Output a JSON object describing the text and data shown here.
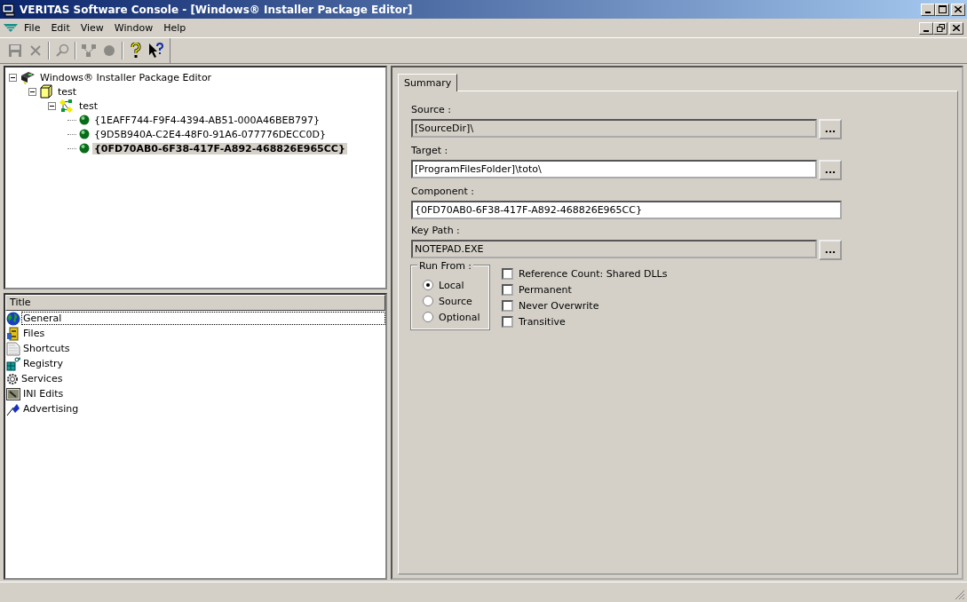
{
  "window": {
    "title": "VERITAS Software Console - [Windows® Installer Package Editor]"
  },
  "menu": [
    "File",
    "Edit",
    "View",
    "Window",
    "Help"
  ],
  "toolbar": [
    {
      "kind": "save",
      "disabled": true
    },
    {
      "kind": "delete",
      "disabled": true
    },
    {
      "kind": "separator"
    },
    {
      "kind": "find",
      "disabled": true
    },
    {
      "kind": "separator"
    },
    {
      "kind": "tree",
      "disabled": true
    },
    {
      "kind": "ball",
      "disabled": true
    },
    {
      "kind": "separator"
    },
    {
      "kind": "help",
      "disabled": false
    },
    {
      "kind": "whats-this",
      "disabled": false
    }
  ],
  "tree": [
    {
      "label": "Windows® Installer Package Editor",
      "kind": "package",
      "expanded": true,
      "selected": false,
      "children": [
        {
          "label": "test",
          "kind": "box",
          "expanded": true,
          "selected": false,
          "children": [
            {
              "label": "test",
              "kind": "network",
              "expanded": true,
              "selected": false,
              "children": [
                {
                  "label": "{1EAFF744-F9F4-4394-AB51-000A46BEB797}",
                  "kind": "ball",
                  "selected": false
                },
                {
                  "label": "{9D5B940A-C2E4-48F0-91A6-077776DECC0D}",
                  "kind": "ball",
                  "selected": false
                },
                {
                  "label": "{0FD70AB0-6F38-417F-A892-468826E965CC}",
                  "kind": "ball",
                  "selected": true
                }
              ]
            }
          ]
        }
      ]
    }
  ],
  "list": {
    "column": "Title",
    "items": [
      {
        "label": "General",
        "kind": "globe",
        "selected": true
      },
      {
        "label": "Files",
        "kind": "files",
        "selected": false
      },
      {
        "label": "Shortcuts",
        "kind": "shortcut",
        "selected": false
      },
      {
        "label": "Registry",
        "kind": "registry",
        "selected": false
      },
      {
        "label": "Services",
        "kind": "gear",
        "selected": false
      },
      {
        "label": "INI Edits",
        "kind": "ini",
        "selected": false
      },
      {
        "label": "Advertising",
        "kind": "advert",
        "selected": false
      }
    ]
  },
  "tabs": [
    {
      "label": "Summary",
      "selected": true
    }
  ],
  "fields": [
    {
      "label": "Source :",
      "value": "[SourceDir]\\",
      "disabled": true,
      "browse": "..."
    },
    {
      "label": "Target :",
      "value": "[ProgramFilesFolder]\\toto\\",
      "disabled": false,
      "browse": "..."
    },
    {
      "label": "Component :",
      "value": "{0FD70AB0-6F38-417F-A892-468826E965CC}",
      "disabled": false
    },
    {
      "label": "Key Path :",
      "value": "NOTEPAD.EXE",
      "disabled": true,
      "browse": "..."
    }
  ],
  "run_from": {
    "label": "Run From :",
    "options": [
      {
        "label": "Local",
        "selected": true
      },
      {
        "label": "Source",
        "selected": false
      },
      {
        "label": "Optional",
        "selected": false
      }
    ]
  },
  "options": [
    {
      "label": "Reference Count: Shared DLLs",
      "checked": false
    },
    {
      "label": "Permanent",
      "checked": false
    },
    {
      "label": "Never Overwrite",
      "checked": false
    },
    {
      "label": "Transitive",
      "checked": false
    }
  ]
}
